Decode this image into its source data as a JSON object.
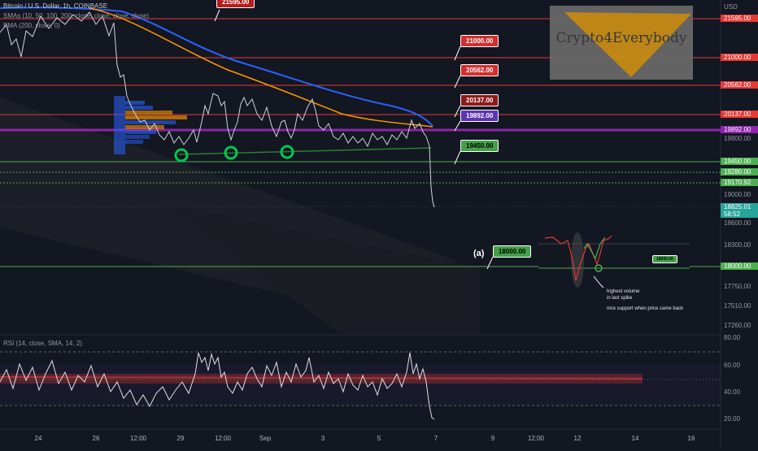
{
  "header": {
    "title": "Bitcoin / U.S. Dollar, 1h, COINBASE",
    "smas": "SMAs (10, 50, 100, 200, close, close, close, close)",
    "ema": "EMA (200, close, 0)"
  },
  "price_axis": {
    "currency": "USD",
    "labels": [
      "21595.00",
      "21000.00",
      "20562.00",
      "20137.00",
      "19892.00",
      "19800.00",
      "19450.00",
      "19280.00",
      "19170.92",
      "19000.00",
      "18825.01",
      "58:52",
      "18600.00",
      "18300.00",
      "18000.00",
      "17750.00",
      "17510.00",
      "17260.00"
    ]
  },
  "rsi_axis": {
    "labels": [
      "80.00",
      "60.00",
      "40.00",
      "20.00"
    ]
  },
  "rsi_header": "RSI (14, close, SMA, 14, 2)",
  "time_axis": {
    "labels": [
      "24",
      "26",
      "12:00",
      "29",
      "12:00",
      "Sep",
      "3",
      "5",
      "7",
      "9",
      "12:00",
      "12",
      "14",
      "16"
    ]
  },
  "tags": {
    "t21595": "21595.00",
    "t21000": "21000.00",
    "t20562": "20562.00",
    "t20137": "20137.00",
    "t19892": "19892.00",
    "t19450": "19450.00",
    "t18000": "18000.00",
    "inset18000": "18000.00"
  },
  "annotation": {
    "label": "(a)"
  },
  "inset": {
    "note1": "highest volume",
    "note2": "in last spike",
    "note3": "nice support when price came back"
  },
  "logo": {
    "text": "Crypto4Everybody"
  },
  "colors": {
    "bg": "#131722",
    "red": "#e53935",
    "green": "#4caf50",
    "purple": "#8e24aa",
    "blue": "#2962ff",
    "orange": "#ff9800",
    "teal": "#26a69a"
  }
}
